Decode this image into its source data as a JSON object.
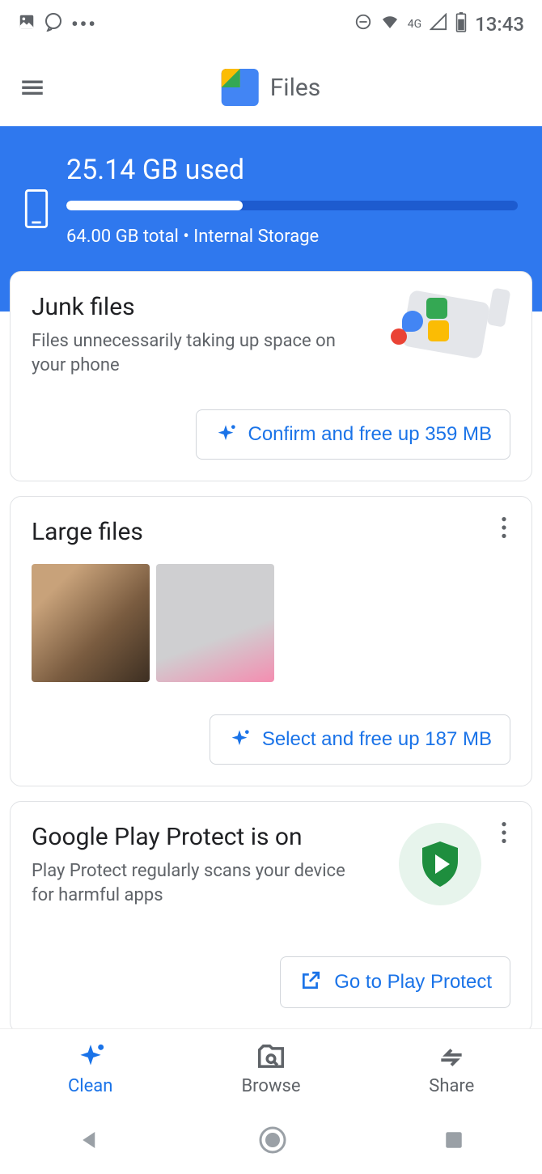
{
  "statusbar": {
    "network": "4G",
    "time": "13:43"
  },
  "header": {
    "title": "Files"
  },
  "storage": {
    "used_label": "25.14 GB used",
    "total_label": "64.00 GB total • Internal Storage",
    "used_percent": 39
  },
  "cards": {
    "junk": {
      "title": "Junk files",
      "subtitle": "Files unnecessarily taking up space on your phone",
      "action": "Confirm and free up 359 MB"
    },
    "large": {
      "title": "Large files",
      "action": "Select and free up 187 MB"
    },
    "protect": {
      "title": "Google Play Protect is on",
      "subtitle": "Play Protect regularly scans your device for harmful apps",
      "action": "Go to Play Protect"
    }
  },
  "nav": {
    "clean": "Clean",
    "browse": "Browse",
    "share": "Share"
  }
}
